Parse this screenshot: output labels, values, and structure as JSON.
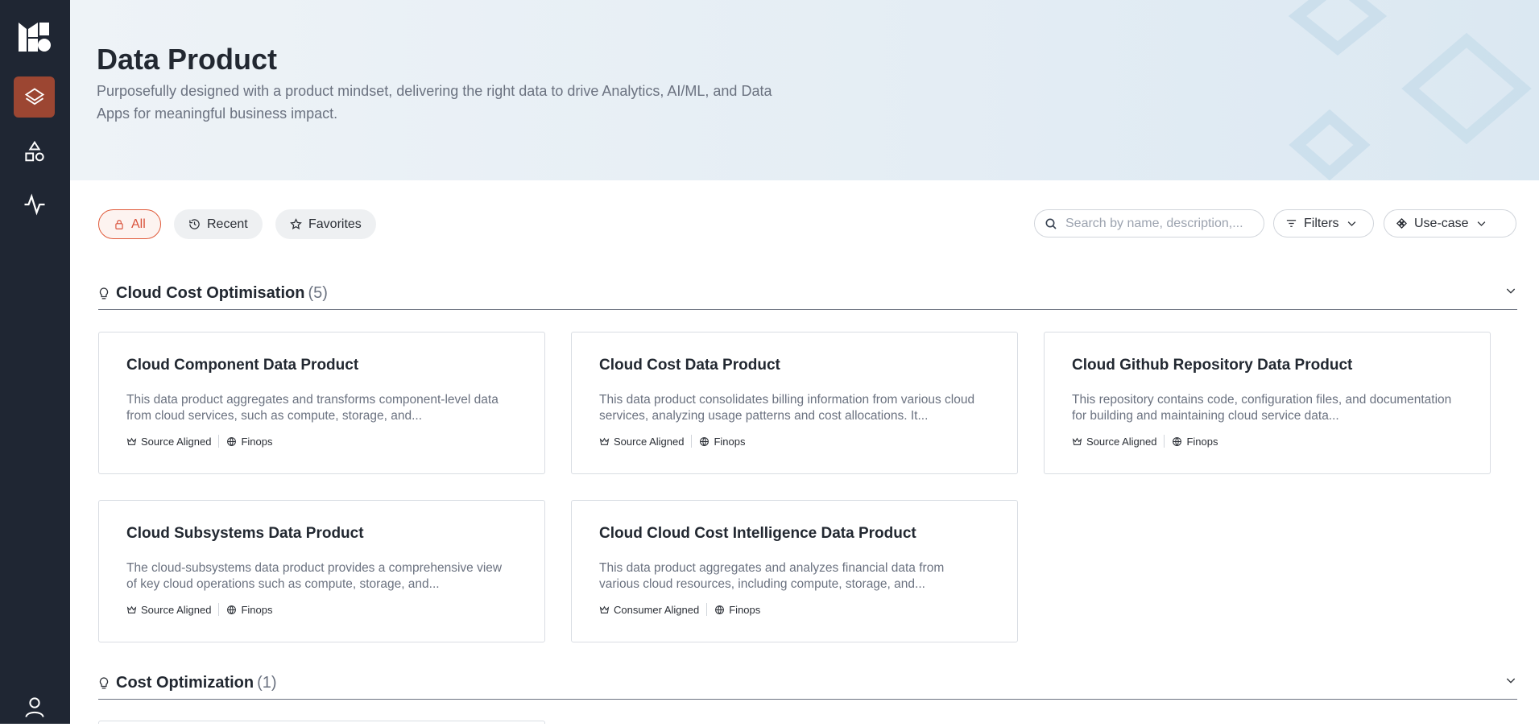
{
  "sidebar": {
    "logo": "brand-logo-icon",
    "items": [
      {
        "icon": "layers-icon",
        "active": true
      },
      {
        "icon": "shapes-icon",
        "active": false
      },
      {
        "icon": "activity-icon",
        "active": false
      }
    ],
    "footer_icon": "user-icon"
  },
  "header": {
    "title": "Data Product",
    "subtitle": "Purposefully designed with a product mindset, delivering the right data to drive Analytics, AI/ML, and Data Apps for meaningful business impact."
  },
  "toolbar": {
    "tabs": [
      {
        "label": "All",
        "icon": "lock-icon",
        "active": true
      },
      {
        "label": "Recent",
        "icon": "history-icon",
        "active": false
      },
      {
        "label": "Favorites",
        "icon": "star-icon",
        "active": false
      }
    ],
    "search": {
      "placeholder": "Search by name, description,...",
      "value": ""
    },
    "filters_label": "Filters",
    "usecase_label": "Use-case"
  },
  "sections": [
    {
      "title": "Cloud Cost Optimisation",
      "count": "(5)",
      "cards": [
        {
          "title": "Cloud Component Data Product",
          "description": "This data product aggregates and transforms component-level data from cloud services, such as compute, storage, and...",
          "tag1": "Source Aligned",
          "tag2": "Finops"
        },
        {
          "title": "Cloud Cost Data Product",
          "description": "This data product consolidates billing information from various cloud services, analyzing usage patterns and cost allocations. It...",
          "tag1": "Source Aligned",
          "tag2": "Finops"
        },
        {
          "title": "Cloud Github Repository Data Product",
          "description": "This repository contains code, configuration files, and documentation for building and maintaining cloud service data...",
          "tag1": "Source Aligned",
          "tag2": "Finops"
        },
        {
          "title": "Cloud Subsystems Data Product",
          "description": "The cloud-subsystems data product provides a comprehensive view of key cloud operations such as compute, storage, and...",
          "tag1": "Source Aligned",
          "tag2": "Finops"
        },
        {
          "title": "Cloud Cloud Cost Intelligence Data Product",
          "description": "This data product aggregates and analyzes financial data from various cloud resources, including compute, storage, and...",
          "tag1": "Consumer Aligned",
          "tag2": "Finops"
        }
      ]
    },
    {
      "title": "Cost Optimization",
      "count": "(1)",
      "cards": []
    }
  ],
  "colors": {
    "accent": "#d9513a",
    "sidebar": "#1f2633",
    "active_nav": "#9c4632"
  }
}
